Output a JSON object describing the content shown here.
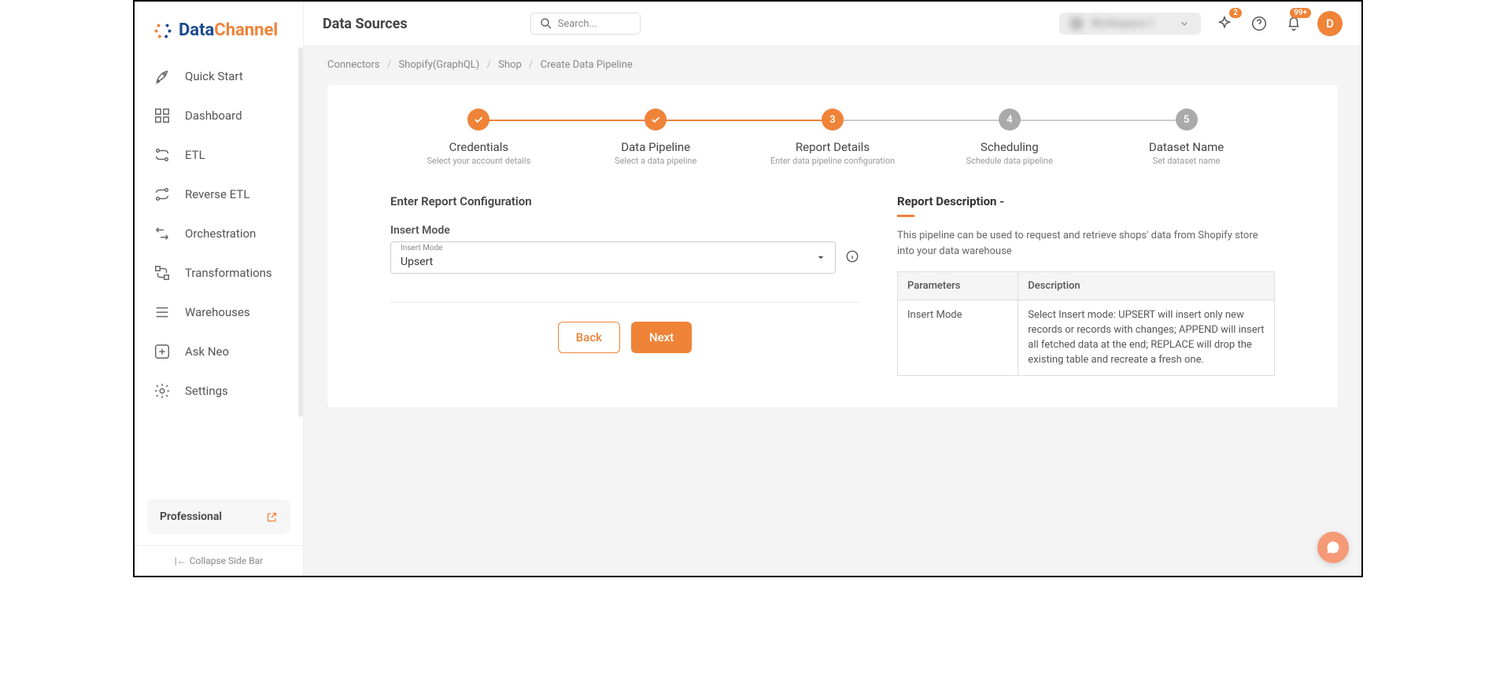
{
  "brand": {
    "part1": "Data",
    "part2": "Channel"
  },
  "sidebar": {
    "items": [
      {
        "label": "Quick Start",
        "icon": "rocket"
      },
      {
        "label": "Dashboard",
        "icon": "dashboard"
      },
      {
        "label": "ETL",
        "icon": "etl"
      },
      {
        "label": "Reverse ETL",
        "icon": "reverse-etl"
      },
      {
        "label": "Orchestration",
        "icon": "orchestration"
      },
      {
        "label": "Transformations",
        "icon": "transformations"
      },
      {
        "label": "Warehouses",
        "icon": "warehouses"
      },
      {
        "label": "Ask Neo",
        "icon": "ask"
      },
      {
        "label": "Settings",
        "icon": "settings"
      }
    ],
    "plan": "Professional",
    "collapse_label": "Collapse Side Bar"
  },
  "header": {
    "title": "Data Sources",
    "search_placeholder": "Search...",
    "workspace_label": "Workspace 1",
    "sparkle_badge": "2",
    "bell_badge": "99+",
    "avatar_initial": "D"
  },
  "breadcrumb": {
    "items": [
      "Connectors",
      "Shopify(GraphQL)",
      "Shop",
      "Create Data Pipeline"
    ]
  },
  "stepper": [
    {
      "title": "Credentials",
      "sub": "Select your account details",
      "state": "completed"
    },
    {
      "title": "Data Pipeline",
      "sub": "Select a data pipeline",
      "state": "completed"
    },
    {
      "title": "Report Details",
      "sub": "Enter data pipeline configuration",
      "state": "active",
      "num": "3"
    },
    {
      "title": "Scheduling",
      "sub": "Schedule data pipeline",
      "state": "pending",
      "num": "4"
    },
    {
      "title": "Dataset Name",
      "sub": "Set dataset name",
      "state": "pending",
      "num": "5"
    }
  ],
  "form": {
    "section_heading": "Enter Report Configuration",
    "insert_mode": {
      "label": "Insert Mode",
      "float_label": "Insert Mode",
      "value": "Upsert"
    },
    "buttons": {
      "back": "Back",
      "next": "Next"
    }
  },
  "description": {
    "heading": "Report Description -",
    "text": "This pipeline can be used to request and retrieve shops' data from Shopify store into your data warehouse",
    "table": {
      "headers": [
        "Parameters",
        "Description"
      ],
      "rows": [
        {
          "param": "Insert Mode",
          "desc": "Select Insert mode: UPSERT will insert only new records or records with changes; APPEND will insert all fetched data at the end; REPLACE will drop the existing table and recreate a fresh one."
        }
      ]
    }
  }
}
